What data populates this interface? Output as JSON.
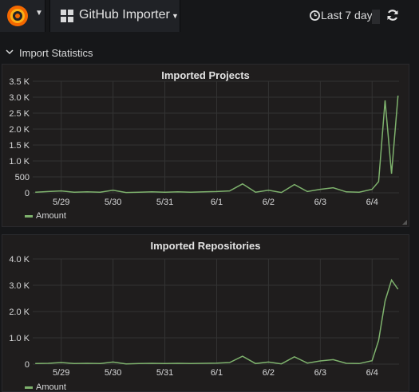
{
  "header": {
    "dashboard_title": "GitHub Importer",
    "time_range_label": "Last 7 day...",
    "icons": [
      "grafana-logo-icon",
      "dashboard-grid-icon",
      "clock-icon",
      "refresh-icon"
    ]
  },
  "row": {
    "title": "Import Statistics"
  },
  "colors": {
    "series": "#7eb26d",
    "grid": "#333333",
    "panel_bg": "#1f1d1d",
    "page_bg": "#161719"
  },
  "panels": [
    {
      "title": "Imported Projects",
      "legend": "Amount"
    },
    {
      "title": "Imported Repositories",
      "legend": "Amount"
    }
  ],
  "chart_data": [
    {
      "type": "line",
      "title": "Imported Projects",
      "x_ticks": [
        "5/29",
        "5/30",
        "5/31",
        "6/1",
        "6/2",
        "6/3",
        "6/4"
      ],
      "y_ticks": [
        "0",
        "500",
        "1.0 K",
        "1.5 K",
        "2.0 K",
        "2.5 K",
        "3.0 K",
        "3.5 K"
      ],
      "ylim": [
        0,
        3500
      ],
      "grid": true,
      "legend_position": "bottom-left",
      "series": [
        {
          "name": "Amount",
          "x": [
            "5/28 12:00",
            "5/28 18:00",
            "5/29 00:00",
            "5/29 06:00",
            "5/29 12:00",
            "5/29 18:00",
            "5/30 00:00",
            "5/30 06:00",
            "5/30 12:00",
            "5/30 18:00",
            "5/31 00:00",
            "5/31 06:00",
            "5/31 12:00",
            "5/31 18:00",
            "6/1 00:00",
            "6/1 06:00",
            "6/1 12:00",
            "6/1 18:00",
            "6/2 00:00",
            "6/2 06:00",
            "6/2 12:00",
            "6/2 18:00",
            "6/3 00:00",
            "6/3 06:00",
            "6/3 12:00",
            "6/3 18:00",
            "6/4 00:00",
            "6/4 03:00",
            "6/4 06:00",
            "6/4 09:00",
            "6/4 12:00"
          ],
          "values": [
            20,
            40,
            60,
            20,
            30,
            20,
            80,
            10,
            20,
            30,
            20,
            30,
            20,
            30,
            40,
            60,
            280,
            20,
            80,
            10,
            260,
            40,
            110,
            160,
            30,
            20,
            110,
            350,
            2900,
            600,
            3050
          ]
        }
      ]
    },
    {
      "type": "line",
      "title": "Imported Repositories",
      "x_ticks": [
        "5/29",
        "5/30",
        "5/31",
        "6/1",
        "6/2",
        "6/3",
        "6/4"
      ],
      "y_ticks": [
        "0",
        "1.0 K",
        "2.0 K",
        "3.0 K",
        "4.0 K"
      ],
      "ylim": [
        0,
        4000
      ],
      "grid": true,
      "legend_position": "bottom-left",
      "series": [
        {
          "name": "Amount",
          "x": [
            "5/28 12:00",
            "5/28 18:00",
            "5/29 00:00",
            "5/29 06:00",
            "5/29 12:00",
            "5/29 18:00",
            "5/30 00:00",
            "5/30 06:00",
            "5/30 12:00",
            "5/30 18:00",
            "5/31 00:00",
            "5/31 06:00",
            "5/31 12:00",
            "5/31 18:00",
            "6/1 00:00",
            "6/1 06:00",
            "6/1 12:00",
            "6/1 18:00",
            "6/2 00:00",
            "6/2 06:00",
            "6/2 12:00",
            "6/2 18:00",
            "6/3 00:00",
            "6/3 06:00",
            "6/3 12:00",
            "6/3 18:00",
            "6/4 00:00",
            "6/4 03:00",
            "6/4 06:00",
            "6/4 09:00",
            "6/4 12:00"
          ],
          "values": [
            20,
            30,
            60,
            20,
            30,
            20,
            80,
            10,
            20,
            30,
            20,
            30,
            20,
            30,
            40,
            60,
            300,
            20,
            80,
            10,
            280,
            40,
            120,
            170,
            30,
            20,
            130,
            900,
            2400,
            3200,
            2850
          ]
        }
      ]
    }
  ]
}
